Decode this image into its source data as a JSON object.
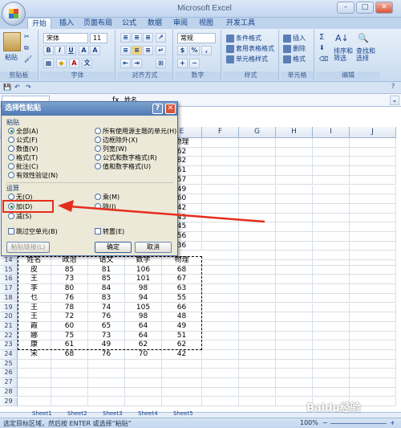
{
  "window": {
    "title": "Microsoft Excel"
  },
  "tabs": [
    "开始",
    "插入",
    "页面布局",
    "公式",
    "数据",
    "审阅",
    "视图",
    "开发工具"
  ],
  "ribbon": {
    "paste": "粘贴",
    "font_name": "宋体",
    "font_size": "11",
    "number_format": "常规",
    "cond_format": "条件格式",
    "table_format": "套用表格格式",
    "cell_style": "单元格样式",
    "insert": "插入",
    "delete": "删除",
    "format": "格式",
    "sort_filter": "排序和\n筛选",
    "find_select": "查找和\n选择",
    "groups": [
      "剪贴板",
      "字体",
      "对齐方式",
      "数字",
      "样式",
      "单元格",
      "编辑"
    ]
  },
  "formula_bar": {
    "name_box": "",
    "value": "姓名"
  },
  "columns": [
    "A",
    "B",
    "C",
    "D",
    "E",
    "F",
    "G",
    "H",
    "I",
    "J"
  ],
  "table": {
    "hidden_header_e": "物理",
    "visible_e_values": [
      "62",
      "82",
      "61",
      "57",
      "49",
      "60",
      "42",
      "43",
      "45",
      "56",
      "36"
    ],
    "header_row": 14,
    "headers": [
      "姓名",
      "政治",
      "语文",
      "数学",
      "物理"
    ],
    "rows": [
      {
        "n": "15",
        "cells": [
          "皮",
          "85",
          "81",
          "106",
          "68"
        ]
      },
      {
        "n": "16",
        "cells": [
          "王",
          "73",
          "85",
          "101",
          "67"
        ]
      },
      {
        "n": "17",
        "cells": [
          "李",
          "80",
          "84",
          "98",
          "63"
        ]
      },
      {
        "n": "18",
        "cells": [
          "乜",
          "76",
          "83",
          "94",
          "55"
        ]
      },
      {
        "n": "19",
        "cells": [
          "王",
          "78",
          "74",
          "105",
          "66"
        ]
      },
      {
        "n": "20",
        "cells": [
          "王",
          "72",
          "76",
          "98",
          "48"
        ]
      },
      {
        "n": "21",
        "cells": [
          "霞",
          "60",
          "65",
          "64",
          "49"
        ]
      },
      {
        "n": "22",
        "cells": [
          "娜",
          "75",
          "73",
          "64",
          "51"
        ]
      },
      {
        "n": "23",
        "cells": [
          "康",
          "61",
          "49",
          "62",
          "62"
        ]
      },
      {
        "n": "24",
        "cells": [
          "宋",
          "68",
          "76",
          "70",
          "42"
        ]
      }
    ],
    "extra_rows": [
      "25",
      "26",
      "27",
      "28",
      "29",
      "30",
      "31",
      "32"
    ]
  },
  "dialog": {
    "title": "选择性粘贴",
    "paste_section": "粘贴",
    "paste_options_left": [
      "全部(A)",
      "公式(F)",
      "数值(V)",
      "格式(T)",
      "批注(C)",
      "有效性验证(N)"
    ],
    "paste_options_right": [
      "所有使用源主题的单元(H)",
      "边框除外(X)",
      "列宽(W)",
      "公式和数字格式(R)",
      "值和数字格式(U)"
    ],
    "op_section": "运算",
    "op_left": [
      "无(O)",
      "加(D)",
      "减(S)"
    ],
    "op_right": [
      "乘(M)",
      "除(I)"
    ],
    "skip_blanks": "跳过空单元(B)",
    "transpose": "转置(E)",
    "paste_link": "粘贴链接(L)",
    "ok": "确定",
    "cancel": "取消"
  },
  "sheets": [
    "Sheet1",
    "Sheet2",
    "Sheet3",
    "Sheet4",
    "Sheet5"
  ],
  "status": {
    "message": "选定目标区域，然后按 ENTER 或选择“粘贴”",
    "zoom": "100%"
  },
  "watermark": "Baidu经验",
  "colors": {
    "highlight_red": "#e62d1c",
    "ribbon": "#cadcf0",
    "dialog_bg": "#ece9d8"
  }
}
